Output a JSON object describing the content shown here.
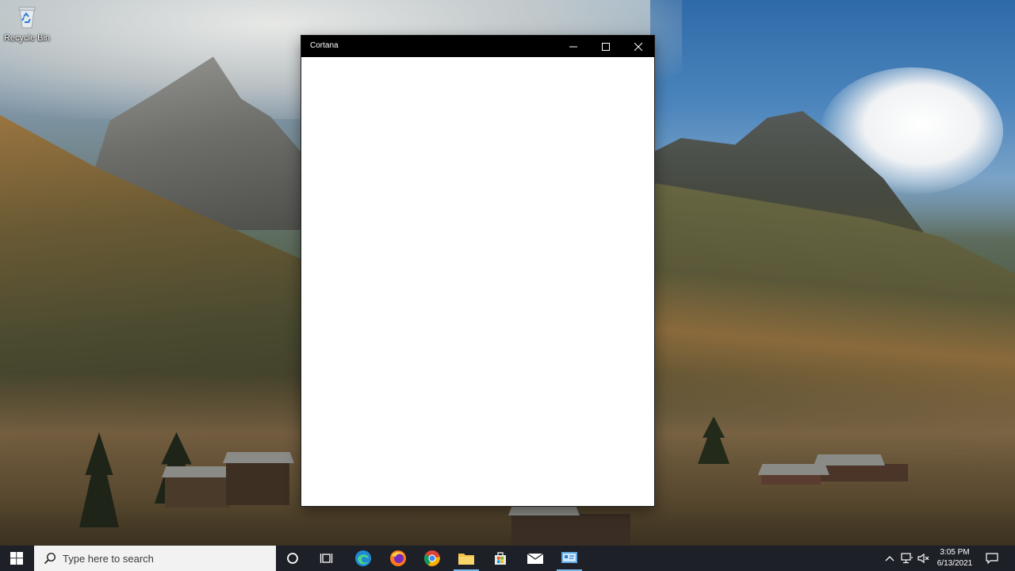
{
  "desktop": {
    "icons": [
      {
        "label": "Recycle Bin",
        "icon": "recycle-bin-icon"
      }
    ]
  },
  "window": {
    "title": "Cortana",
    "controls": {
      "minimize": "minimize-icon",
      "maximize": "maximize-icon",
      "close": "close-icon"
    }
  },
  "taskbar": {
    "search_placeholder": "Type here to search",
    "apps": [
      {
        "name": "cortana",
        "icon": "cortana-ring-icon"
      },
      {
        "name": "task-view",
        "icon": "task-view-icon"
      },
      {
        "name": "edge",
        "icon": "edge-icon"
      },
      {
        "name": "firefox",
        "icon": "firefox-icon"
      },
      {
        "name": "chrome",
        "icon": "chrome-icon"
      },
      {
        "name": "file-explorer",
        "icon": "folder-icon",
        "active": true
      },
      {
        "name": "microsoft-store",
        "icon": "store-icon"
      },
      {
        "name": "mail",
        "icon": "mail-icon"
      },
      {
        "name": "control-panel",
        "icon": "control-panel-icon",
        "active": true
      }
    ],
    "tray": {
      "time": "3:05 PM",
      "date": "6/13/2021"
    },
    "accent_color": "#76b9ed"
  }
}
